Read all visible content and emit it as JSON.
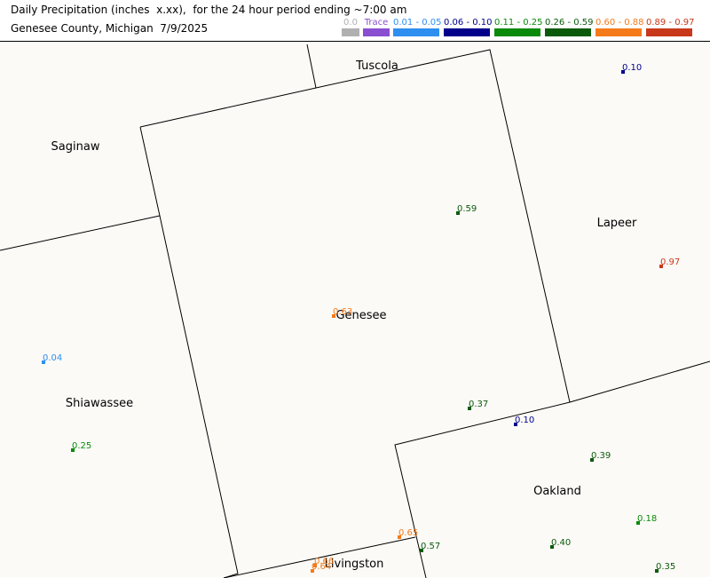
{
  "header": {
    "title_line1": "Daily Precipitation (inches  x.xx),  for the 24 hour period ending ~7:00 am",
    "title_line2": "Genesee County, Michigan  7/9/2025"
  },
  "legend": [
    {
      "label": "0.0",
      "color": "#b0b0b0",
      "label_color": "#b0b0b0"
    },
    {
      "label": "Trace",
      "color": "#8a4fd0",
      "label_color": "#8a4fd0"
    },
    {
      "label": "0.01 - 0.05",
      "color": "#2f8ff0",
      "label_color": "#2f8ff0"
    },
    {
      "label": "0.06 - 0.10",
      "color": "#00008b",
      "label_color": "#00008b"
    },
    {
      "label": "0.11 - 0.25",
      "color": "#0a8a0a",
      "label_color": "#0a8a0a"
    },
    {
      "label": "0.26 - 0.59",
      "color": "#0b5a0b",
      "label_color": "#0b5a0b"
    },
    {
      "label": "0.60 - 0.88",
      "color": "#f47a1a",
      "label_color": "#f47a1a"
    },
    {
      "label": "0.89 - 0.97",
      "color": "#c8381a",
      "label_color": "#c8381a"
    }
  ],
  "counties": [
    "Tuscola",
    "Saginaw",
    "Lapeer",
    "Genesee",
    "Shiawassee",
    "Oakland",
    "Livingston"
  ],
  "stations": [
    {
      "value": "0.10",
      "color": "#00008b"
    },
    {
      "value": "0.59",
      "color": "#0b5a0b"
    },
    {
      "value": "0.97",
      "color": "#c8381a"
    },
    {
      "value": "0.63",
      "color": "#f47a1a"
    },
    {
      "value": "0.04",
      "color": "#2f8ff0"
    },
    {
      "value": "0.37",
      "color": "#0b5a0b"
    },
    {
      "value": "0.10",
      "color": "#00008b"
    },
    {
      "value": "0.25",
      "color": "#0a8a0a"
    },
    {
      "value": "0.39",
      "color": "#0b5a0b"
    },
    {
      "value": "0.18",
      "color": "#0a8a0a"
    },
    {
      "value": "0.65",
      "color": "#f47a1a"
    },
    {
      "value": "0.57",
      "color": "#0b5a0b"
    },
    {
      "value": "0.40",
      "color": "#0b5a0b"
    },
    {
      "value": "0.35",
      "color": "#0b5a0b"
    },
    {
      "value": "0.66",
      "color": "#f47a1a"
    },
    {
      "value": "0.64",
      "color": "#f47a1a"
    }
  ]
}
